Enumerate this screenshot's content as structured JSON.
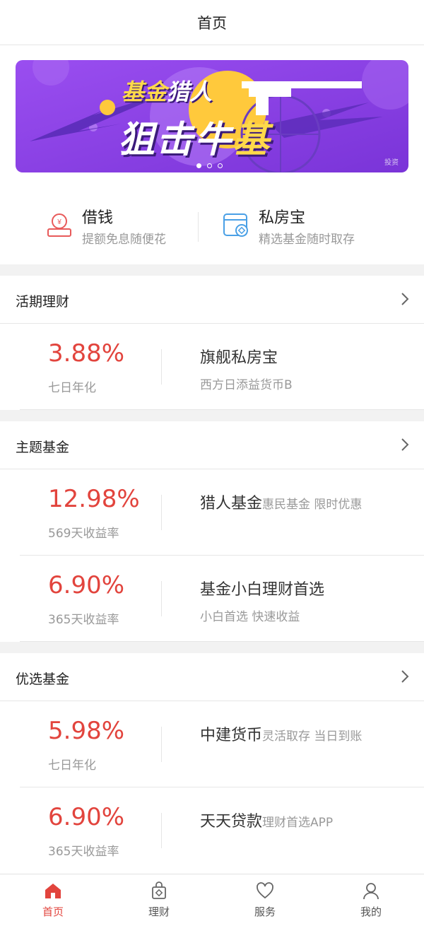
{
  "header": {
    "title": "首页"
  },
  "banner": {
    "line1_part1": "基金",
    "line1_part2": "猎人",
    "line2_part1": "狙击牛",
    "line2_part2": "基",
    "tag": "投资",
    "dots": 3,
    "active_dot": 0,
    "colors": {
      "bg": "#8a3fe0",
      "accent": "#ffd94a"
    }
  },
  "quick": [
    {
      "title": "借钱",
      "subtitle": "提额免息随便花",
      "icon": "loan-icon"
    },
    {
      "title": "私房宝",
      "subtitle": "精选基金随时取存",
      "icon": "wallet-icon"
    }
  ],
  "sections": [
    {
      "title": "活期理财",
      "items": [
        {
          "rate": "3.88%",
          "rate_label": "七日年化",
          "name": "旗舰私房宝",
          "name_inline": "",
          "subtitle": "西方日添益货币B"
        }
      ]
    },
    {
      "title": "主题基金",
      "items": [
        {
          "rate": "12.98%",
          "rate_label": "569天收益率",
          "name": "猎人基金",
          "name_inline": "惠民基金 限时优惠",
          "subtitle": ""
        },
        {
          "rate": "6.90%",
          "rate_label": "365天收益率",
          "name": "基金小白理财首选",
          "name_inline": "",
          "subtitle": "小白首选 快速收益"
        }
      ]
    },
    {
      "title": "优选基金",
      "items": [
        {
          "rate": "5.98%",
          "rate_label": "七日年化",
          "name": "中建货币",
          "name_inline": "灵活取存 当日到账",
          "subtitle": ""
        },
        {
          "rate": "6.90%",
          "rate_label": "365天收益率",
          "name": "天天贷款",
          "name_inline": "理财首选APP",
          "subtitle": ""
        }
      ]
    }
  ],
  "tabbar": {
    "items": [
      {
        "label": "首页",
        "icon": "home-icon",
        "active": true
      },
      {
        "label": "理财",
        "icon": "bag-icon",
        "active": false
      },
      {
        "label": "服务",
        "icon": "heart-icon",
        "active": false
      },
      {
        "label": "我的",
        "icon": "user-icon",
        "active": false
      }
    ],
    "active_color": "#e2443d"
  },
  "theme": {
    "rate_color": "#e2443d",
    "muted_text": "#999999"
  }
}
